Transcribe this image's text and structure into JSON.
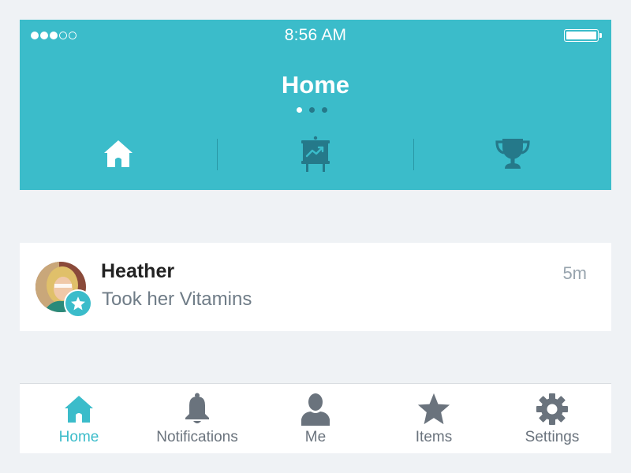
{
  "status_bar": {
    "time": "8:56 AM",
    "signal_bars_filled": 3,
    "signal_bars_total": 5,
    "battery_level": 1.0
  },
  "header": {
    "title": "Home",
    "page_count": 3,
    "active_page": 1,
    "tabs": [
      {
        "icon": "home-icon",
        "active": true
      },
      {
        "icon": "chart-easel-icon",
        "active": false
      },
      {
        "icon": "trophy-icon",
        "active": false
      }
    ]
  },
  "feed": {
    "items": [
      {
        "name": "Heather",
        "action": "Took her Vitamins",
        "time": "5m",
        "badge_icon": "star-icon"
      }
    ]
  },
  "tabbar": {
    "items": [
      {
        "label": "Home",
        "icon": "home-icon",
        "active": true
      },
      {
        "label": "Notifications",
        "icon": "bell-icon",
        "active": false
      },
      {
        "label": "Me",
        "icon": "person-icon",
        "active": false
      },
      {
        "label": "Items",
        "icon": "star-icon",
        "active": false
      },
      {
        "label": "Settings",
        "icon": "gear-icon",
        "active": false
      }
    ]
  },
  "colors": {
    "accent": "#3bbcca",
    "header_icon_inactive": "#25798a",
    "tab_inactive": "#6a737d",
    "background": "#eff2f5"
  }
}
